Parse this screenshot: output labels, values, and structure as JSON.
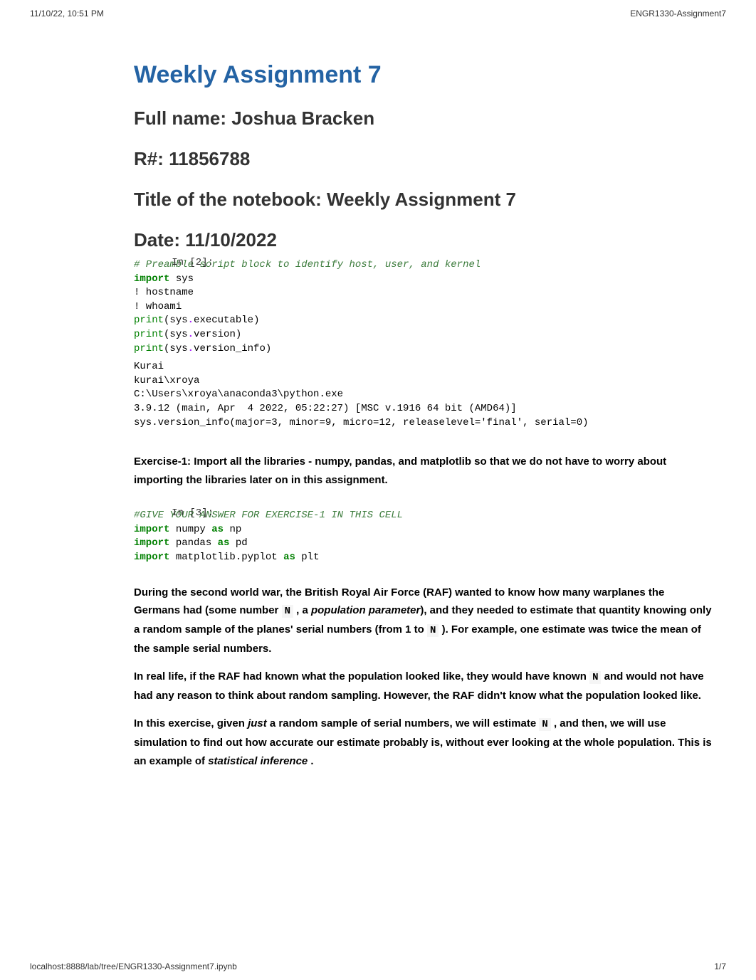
{
  "header": {
    "timestamp": "11/10/22, 10:51 PM",
    "doc_title": "ENGR1330-Assignment7"
  },
  "title": "Weekly Assignment 7",
  "subs": {
    "name_label": "Full name: Joshua Bracken",
    "rnum_label": "R#: 11856788",
    "notebook_title": "Title of the notebook: Weekly Assignment 7",
    "date_label": "Date: 11/10/2022"
  },
  "cell2": {
    "prompt": "In [2]:",
    "comment": "# Preamble script block to identify host, user, and kernel",
    "kw_import": "import",
    "sys": " sys",
    "bang1": "!",
    "hostname": " hostname",
    "bang2": "!",
    "whoami": " whoami",
    "p1a": "print",
    "p1b": "(",
    "p1c": "sys",
    "p1d": ".",
    "p1e": "executable",
    "p1f": ")",
    "p2a": "print",
    "p2b": "(",
    "p2c": "sys",
    "p2d": ".",
    "p2e": "version",
    "p2f": ")",
    "p3a": "print",
    "p3b": "(",
    "p3c": "sys",
    "p3d": ".",
    "p3e": "version_info",
    "p3f": ")"
  },
  "out2": {
    "l1": "Kurai",
    "l2": "kurai\\xroya",
    "l3": "C:\\Users\\xroya\\anaconda3\\python.exe",
    "l4": "3.9.12 (main, Apr  4 2022, 05:22:27) [MSC v.1916 64 bit (AMD64)]",
    "l5": "sys.version_info(major=3, minor=9, micro=12, releaselevel='final', serial=0)"
  },
  "ex1_text": {
    "p": "Exercise-1: Import all the libraries - numpy, pandas, and matplotlib so that we do not have to worry about importing the libraries later on in this assignment."
  },
  "cell3": {
    "prompt": "In [3]:",
    "comment": "#GIVE YOUR ANSWER FOR EXERCISE-1 IN THIS CELL",
    "l1k": "import",
    "l1a": " numpy ",
    "l1k2": "as",
    "l1b": " np",
    "l2k": "import",
    "l2a": " pandas ",
    "l2k2": "as",
    "l2b": " pd",
    "l3k": "import",
    "l3a": " matplotlib.pyplot ",
    "l3k2": "as",
    "l3b": " plt"
  },
  "story": {
    "p1a": "During the second world war, the British Royal Air Force (RAF) wanted to know how many warplanes the Germans had (some number ",
    "N": "N",
    "p1b": " , a ",
    "p1_i": "population parameter",
    "p1c": "), and they needed to estimate that quantity knowing only a random sample of the planes' serial numbers (from 1 to ",
    "p1d": " ). For example, one estimate was twice the mean of the sample serial numbers.",
    "p2a": "In real life, if the RAF had known what the population looked like, they would have known ",
    "p2b": " and would not have had any reason to think about random sampling. However, the RAF didn't know what the population looked like.",
    "p3a": "In this exercise, given ",
    "p3_i1": "just",
    "p3b": " a random sample of serial numbers, we will estimate ",
    "p3c": " , and then, we will use simulation to find out how accurate our estimate probably is, without ever looking at the whole population. This is an example of ",
    "p3_i2": "statistical inference",
    "p3d": " ."
  },
  "footer": {
    "url": "localhost:8888/lab/tree/ENGR1330-Assignment7.ipynb",
    "page": "1/7"
  }
}
